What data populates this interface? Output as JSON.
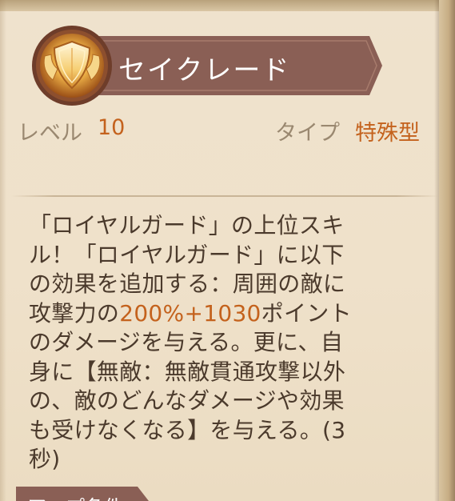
{
  "skill": {
    "name": "セイクレード",
    "icon": "golden-shield-icon"
  },
  "stats": {
    "level_label": "レベル",
    "level_value": "10",
    "type_label": "タイプ",
    "type_value": "特殊型"
  },
  "description": {
    "line1": "「ロイヤルガード」の上位スキ",
    "line2": "ル！「ロイヤルガード」に以下",
    "line3": "の効果を追加する：周囲の敵に",
    "line4_a": "攻撃力の",
    "line4_highlight": "200%+1030",
    "line4_b": "ポイント",
    "line5": "のダメージを与える。更に、自",
    "line6": "身に【無敵：無敵貫通攻撃以外",
    "line7": "の、敵のどんなダメージや効果",
    "line8": "も受けなくなる】を与える。(3",
    "line9": "秒)"
  },
  "next_section": {
    "label": "アップ条件"
  },
  "colors": {
    "banner": "#8a5f55",
    "accent": "#c4621d",
    "muted_label": "#9a8870",
    "body_text": "#4b3a2c",
    "parchment": "#efe1ca"
  }
}
